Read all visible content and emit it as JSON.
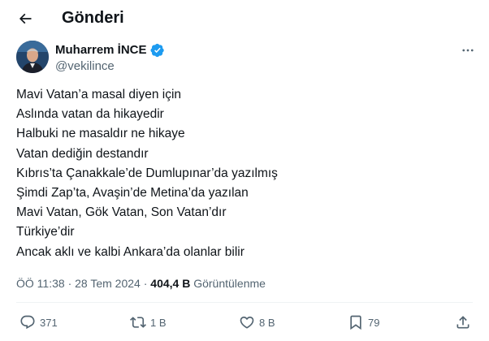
{
  "header": {
    "title": "Gönderi",
    "back_icon": "arrow-left-icon"
  },
  "author": {
    "name": "Muharrem İNCE",
    "handle": "@vekilince",
    "verified_color": "#1d9bf0"
  },
  "tweet": {
    "lines": [
      "Mavi Vatan’a masal diyen için",
      "Aslında vatan da hikayedir",
      "Halbuki ne masaldır ne hikaye",
      "Vatan dediğin destandır",
      "Kıbrıs’ta Çanakkale’de Dumlupınar’da yazılmış",
      "Şimdi Zap’ta, Avaşin’de Metina’da yazılan",
      "Mavi Vatan, Gök Vatan, Son Vatan’dır",
      "Türkiye’dir",
      "Ancak aklı ve kalbi Ankara’da olanlar bilir"
    ]
  },
  "meta": {
    "time": "ÖÖ 11:38",
    "dot1": "·",
    "date": "28 Tem 2024",
    "dot2": "·",
    "views": "404,4 B",
    "views_label": "Görüntülenme"
  },
  "actions": {
    "replies": "371",
    "reposts": "1 B",
    "likes": "8 B",
    "bookmarks": "79"
  },
  "colors": {
    "text": "#0f1419",
    "secondary": "#536471",
    "accent": "#1d9bf0"
  }
}
